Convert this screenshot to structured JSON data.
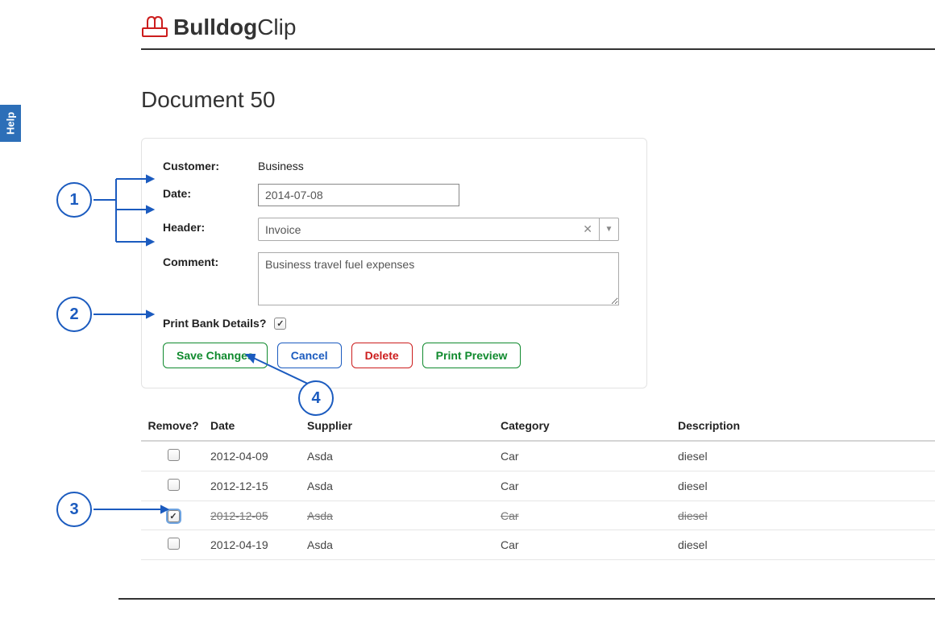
{
  "sidebar": {
    "help": "Help"
  },
  "logo": {
    "bold": "Bulldog",
    "light": "Clip"
  },
  "page": {
    "title": "Document 50"
  },
  "form": {
    "customer_label": "Customer:",
    "customer_value": "Business",
    "date_label": "Date:",
    "date_value": "2014-07-08",
    "header_label": "Header:",
    "header_value": "Invoice",
    "comment_label": "Comment:",
    "comment_value": "Business travel fuel expenses",
    "bank_label": "Print Bank Details?",
    "bank_checked": true
  },
  "buttons": {
    "save": "Save Changes",
    "cancel": "Cancel",
    "delete": "Delete",
    "preview": "Print Preview"
  },
  "table": {
    "headers": {
      "remove": "Remove?",
      "date": "Date",
      "supplier": "Supplier",
      "category": "Category",
      "description": "Description"
    },
    "rows": [
      {
        "removed": false,
        "date": "2012-04-09",
        "supplier": "Asda",
        "category": "Car",
        "description": "diesel"
      },
      {
        "removed": false,
        "date": "2012-12-15",
        "supplier": "Asda",
        "category": "Car",
        "description": "diesel"
      },
      {
        "removed": true,
        "date": "2012-12-05",
        "supplier": "Asda",
        "category": "Car",
        "description": "diesel"
      },
      {
        "removed": false,
        "date": "2012-04-19",
        "supplier": "Asda",
        "category": "Car",
        "description": "diesel"
      }
    ]
  },
  "annotations": {
    "1": "1",
    "2": "2",
    "3": "3",
    "4": "4"
  }
}
